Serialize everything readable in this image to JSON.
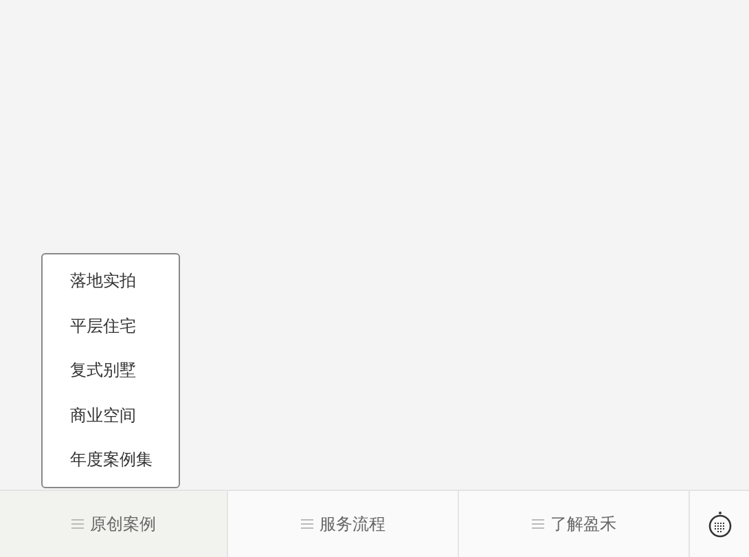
{
  "menu": {
    "items": [
      {
        "label": "落地实拍"
      },
      {
        "label": "平层住宅"
      },
      {
        "label": "复式别墅"
      },
      {
        "label": "商业空间"
      },
      {
        "label": "年度案例集"
      }
    ]
  },
  "tabs": [
    {
      "label": "原创案例",
      "selected": true,
      "expanded": true
    },
    {
      "label": "服务流程",
      "selected": false,
      "expanded": false
    },
    {
      "label": "了解盈禾",
      "selected": false,
      "expanded": false
    }
  ]
}
